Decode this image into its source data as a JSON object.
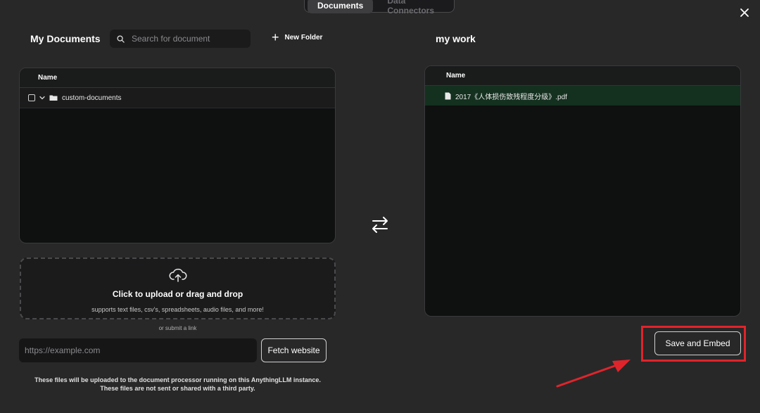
{
  "tabs": [
    {
      "label": "Documents",
      "active": true
    },
    {
      "label": "Data Connectors",
      "active": false
    }
  ],
  "left": {
    "title": "My Documents",
    "search_placeholder": "Search for document",
    "new_folder_label": "New Folder",
    "table_header": "Name",
    "folders": [
      {
        "name": "custom-documents"
      }
    ]
  },
  "right": {
    "title": "my work",
    "table_header": "Name",
    "documents": [
      {
        "name": "2017《人体损伤致残程度分级》.pdf"
      }
    ]
  },
  "upload": {
    "title": "Click to upload or drag and drop",
    "subtitle": "supports text files, csv's, spreadsheets, audio files, and more!",
    "or_link": "or submit a link",
    "url_placeholder": "https://example.com",
    "fetch_label": "Fetch website",
    "notice_line1": "These files will be uploaded to the document processor running on this AnythingLLM instance.",
    "notice_line2": "These files are not sent or shared with a third party."
  },
  "actions": {
    "save_label": "Save and Embed"
  },
  "colors": {
    "highlight": "#e0242b",
    "selected_row": "#14301f"
  },
  "icons": [
    "close-icon",
    "search-icon",
    "plus-icon",
    "folder-icon",
    "chevron-down-icon",
    "file-icon",
    "swap-arrows-icon",
    "cloud-upload-icon",
    "red-arrow"
  ]
}
